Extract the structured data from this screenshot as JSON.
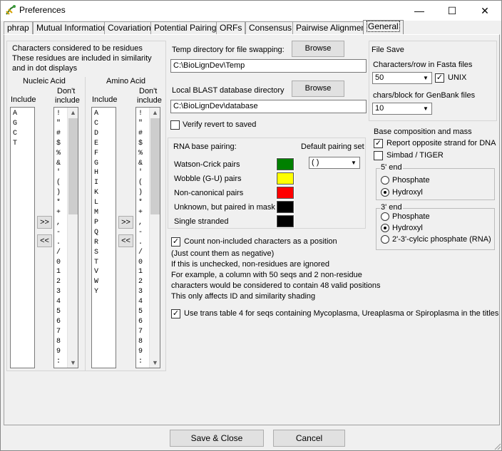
{
  "window": {
    "title": "Preferences",
    "minimize": "—",
    "maximize": "☐",
    "close": "✕"
  },
  "tabs": [
    "phrap",
    "Mutual Information",
    "Covariation",
    "Potential Pairings",
    "ORFs",
    "Consensus",
    "Pairwise Alignment",
    "General"
  ],
  "residues": {
    "heading1": "Characters considered to be residues",
    "heading2": "These residues are included in similarity",
    "heading3": "and in dot displays",
    "nucleic_label": "Nucleic Acid",
    "amino_label": "Amino Acid",
    "include_label": "Include",
    "dont1": "Don't",
    "dont2": "include",
    "nucleic_include": [
      "A",
      "G",
      "C",
      "T"
    ],
    "nucleic_exclude": [
      "!",
      "\"",
      "#",
      "$",
      "%",
      "&",
      "'",
      "(",
      ")",
      "*",
      "+",
      ",",
      "-",
      ".",
      "/",
      "0",
      "1",
      "2",
      "3",
      "4",
      "5",
      "6",
      "7",
      "8",
      "9",
      ":"
    ],
    "amino_include": [
      "A",
      "C",
      "D",
      "E",
      "F",
      "G",
      "H",
      "I",
      "K",
      "L",
      "M",
      "P",
      "Q",
      "R",
      "S",
      "T",
      "V",
      "W",
      "Y"
    ],
    "amino_exclude": [
      "!",
      "\"",
      "#",
      "$",
      "%",
      "&",
      "'",
      "(",
      ")",
      "*",
      "+",
      ",",
      "-",
      ".",
      "/",
      "0",
      "1",
      "2",
      "3",
      "4",
      "5",
      "6",
      "7",
      "8",
      "9",
      ":"
    ],
    "move_right": ">>",
    "move_left": "<<"
  },
  "temp": {
    "label": "Temp directory for file swapping:",
    "browse": "Browse",
    "value": "C:\\BioLignDev\\Temp"
  },
  "blast": {
    "label": "Local BLAST database directory",
    "browse": "Browse",
    "value": "C:\\BioLignDev\\database"
  },
  "verify": {
    "label": "Verify revert to saved",
    "checked": false
  },
  "filesave": {
    "title": "File Save",
    "fasta_label": "Characters/row in Fasta files",
    "fasta_value": "50",
    "unix_label": "UNIX",
    "unix_checked": true,
    "genbank_label": "chars/block for GenBank files",
    "genbank_value": "10"
  },
  "rna": {
    "title": "RNA base pairing:",
    "default_label": "Default pairing set",
    "default_value": "( )",
    "rows": [
      {
        "label": "Watson-Crick pairs",
        "color": "#008000"
      },
      {
        "label": "Wobble (G-U) pairs",
        "color": "#ffff00"
      },
      {
        "label": "Non-canonical pairs",
        "color": "#ff0000"
      },
      {
        "label": "Unknown, but paired in mask",
        "color": "#000000"
      },
      {
        "label": "Single stranded",
        "color": "#000000"
      }
    ]
  },
  "composition": {
    "title": "Base composition and mass",
    "report_label": "Report opposite strand for DNA",
    "report_checked": true,
    "simbad_label": "Simbad / TIGER",
    "simbad_checked": false,
    "end5": {
      "title": "5' end",
      "opt1": "Phosphate",
      "opt2": "Hydroxyl",
      "selected": "Hydroxyl"
    },
    "end3": {
      "title": "3' end",
      "opt1": "Phosphate",
      "opt2": "Hydroxyl",
      "opt3": "2'-3'-cylcic phosphate (RNA)",
      "selected": "Hydroxyl"
    }
  },
  "count": {
    "label": "Count non-included characters as a position",
    "checked": true,
    "note1": "(Just count them as negative)",
    "note2": "If this is unchecked, non-residues are ignored",
    "note3": "For example, a column with 50 seqs and 2 non-residue",
    "note4": "characters would be considered to contain 48 valid positions",
    "note5": "This only affects ID and similarity shading"
  },
  "transtable": {
    "label": "Use trans table 4 for seqs containing Mycoplasma, Ureaplasma or Spiroplasma in the titles",
    "checked": true
  },
  "footer": {
    "save": "Save & Close",
    "cancel": "Cancel"
  },
  "icons": {
    "app": "biolign-icon",
    "check": "✓"
  }
}
